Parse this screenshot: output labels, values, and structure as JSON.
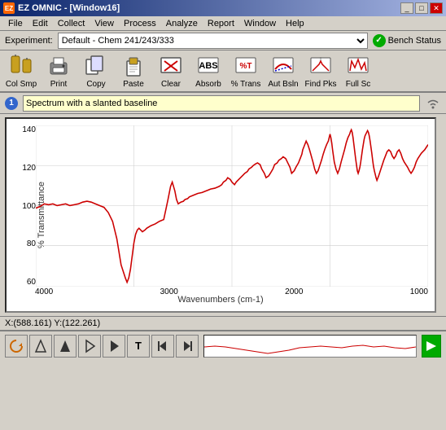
{
  "titleBar": {
    "appName": "EZ OMNIC - [Window16]",
    "icon": "EZ",
    "controls": [
      "_",
      "□",
      "✕"
    ]
  },
  "menuBar": {
    "items": [
      "File",
      "Edit",
      "Collect",
      "View",
      "Process",
      "Analyze",
      "Report",
      "Window",
      "Help"
    ]
  },
  "experimentBar": {
    "label": "Experiment:",
    "value": "Default - Chem 241/243/333",
    "benchStatus": "Bench Status"
  },
  "toolbar": {
    "buttons": [
      {
        "id": "col-smp",
        "label": "Col Smp",
        "icon": "col"
      },
      {
        "id": "print",
        "label": "Print",
        "icon": "print"
      },
      {
        "id": "copy",
        "label": "Copy",
        "icon": "copy"
      },
      {
        "id": "paste",
        "label": "Paste",
        "icon": "paste"
      },
      {
        "id": "clear",
        "label": "Clear",
        "icon": "clear"
      },
      {
        "id": "absorb",
        "label": "Absorb",
        "icon": "absorb"
      },
      {
        "id": "pct-trans",
        "label": "% Trans",
        "icon": "trans"
      },
      {
        "id": "aut-bsln",
        "label": "Aut Bsln",
        "icon": "bsln"
      },
      {
        "id": "find-pks",
        "label": "Find Pks",
        "icon": "peaks"
      },
      {
        "id": "full-sc",
        "label": "Full Sc",
        "icon": "full"
      }
    ]
  },
  "spectrumBar": {
    "number": "1",
    "name": "Spectrum with a slanted baseline"
  },
  "chart": {
    "yAxisLabel": "% Transmittance",
    "xAxisLabel": "Wavenumbers (cm-1)",
    "yTicks": [
      "140",
      "120",
      "100",
      "80",
      "60"
    ],
    "xTicks": [
      "4000",
      "3000",
      "2000",
      "1000"
    ]
  },
  "statusBar": {
    "text": "X:(588.161)  Y:(122.261)"
  },
  "bottomToolbar": {
    "buttons": [
      "↺",
      "▲",
      "▲",
      "▲",
      "▲",
      "T",
      "◀",
      "▶"
    ],
    "arrowRight": "→"
  },
  "colors": {
    "spectrumLine": "#cc0000",
    "background": "#d4d0c8",
    "chartBg": "#ffffff",
    "titleGradientStart": "#0a246a",
    "titleGradientEnd": "#a6b5e3",
    "benchGreen": "#00aa00"
  }
}
